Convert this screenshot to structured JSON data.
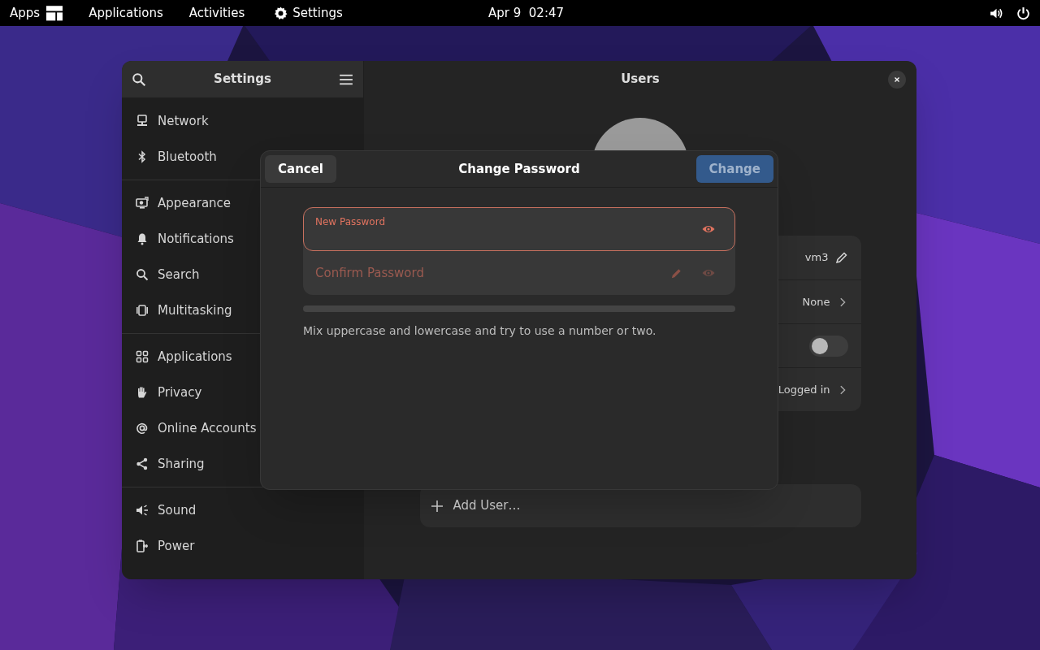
{
  "top_bar": {
    "apps_label": "Apps",
    "menus": [
      "Applications",
      "Activities"
    ],
    "app_menu": "Settings",
    "clock": "Apr 9  02:47"
  },
  "window": {
    "sidebar_title": "Settings",
    "title": "Users"
  },
  "sidebar": {
    "groups": [
      [
        {
          "label": "Network",
          "kind": "network"
        },
        {
          "label": "Bluetooth",
          "kind": "bluetooth"
        }
      ],
      [
        {
          "label": "Appearance",
          "kind": "appearance"
        },
        {
          "label": "Notifications",
          "kind": "bell"
        },
        {
          "label": "Search",
          "kind": "search"
        },
        {
          "label": "Multitasking",
          "kind": "multitasking"
        }
      ],
      [
        {
          "label": "Applications",
          "kind": "grid"
        },
        {
          "label": "Privacy",
          "kind": "hand"
        },
        {
          "label": "Online Accounts",
          "kind": "at"
        },
        {
          "label": "Sharing",
          "kind": "share"
        }
      ],
      [
        {
          "label": "Sound",
          "kind": "sound"
        },
        {
          "label": "Power",
          "kind": "power"
        }
      ]
    ]
  },
  "user_rows": [
    {
      "kind": "edit",
      "value": "vm3"
    },
    {
      "kind": "link",
      "value": "None"
    },
    {
      "kind": "switch",
      "on": false
    },
    {
      "kind": "link",
      "value": "Logged in"
    }
  ],
  "add_user": "Add User…",
  "dialog": {
    "cancel": "Cancel",
    "title": "Change Password",
    "confirm": "Change",
    "confirm_disabled": true,
    "fields": [
      {
        "label": "New Password",
        "focused": true
      },
      {
        "placeholder": "Confirm Password",
        "focused": false
      }
    ],
    "strength": {
      "level": 0
    },
    "hint": "Mix uppercase and lowercase and try to use a number or two."
  }
}
